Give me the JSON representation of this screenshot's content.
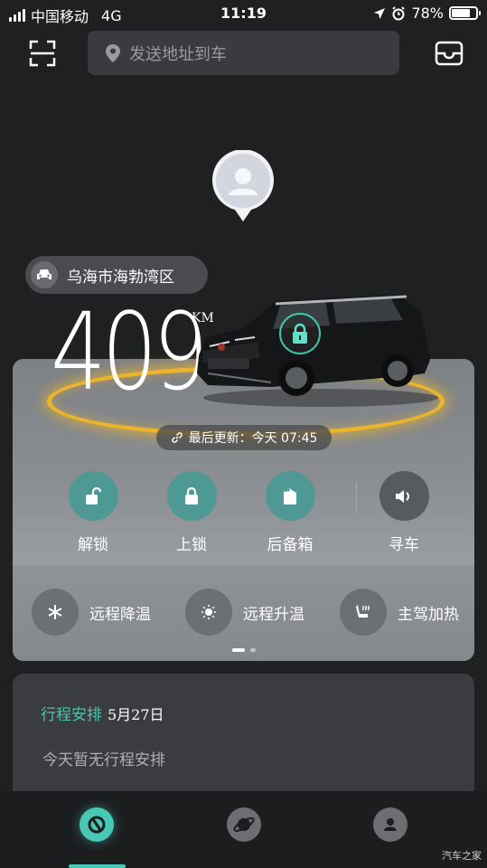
{
  "status_bar": {
    "carrier": "中国移动",
    "network": "4G",
    "time": "11:19",
    "battery": "78%",
    "battery_level": 0.78
  },
  "header": {
    "search_placeholder": "发送地址到车",
    "icons": [
      "scan-icon",
      "location-pin-icon",
      "mail-icon"
    ]
  },
  "vehicle": {
    "location": "乌海市海勃湾区",
    "range_value": "409",
    "range_unit": "KM",
    "last_update": "最后更新：今天 07:45",
    "lock_status_icon": "lock-icon"
  },
  "actions": [
    {
      "label": "解锁",
      "icon": "unlock-icon"
    },
    {
      "label": "上锁",
      "icon": "lock-icon"
    },
    {
      "label": "后备箱",
      "icon": "trunk-icon"
    },
    {
      "label": "寻车",
      "icon": "speaker-icon"
    }
  ],
  "quick_controls": [
    {
      "label": "远程降温",
      "icon": "snowflake-icon"
    },
    {
      "label": "远程升温",
      "icon": "sun-icon"
    },
    {
      "label": "主驾加热",
      "icon": "seat-heat-icon"
    }
  ],
  "pager": {
    "pages": 2,
    "current": 1
  },
  "schedule": {
    "title": "行程安排",
    "date": "5月27日",
    "empty_text": "今天暂无行程安排"
  },
  "tabs": [
    {
      "name": "car",
      "icon": "car-logo-icon",
      "active": true
    },
    {
      "name": "discover",
      "icon": "planet-icon",
      "active": false
    },
    {
      "name": "profile",
      "icon": "user-icon",
      "active": false
    }
  ],
  "watermark": "汽车之家",
  "colors": {
    "accent": "#47c9b6",
    "glow": "#f0b72a",
    "background": "#1f2022"
  }
}
